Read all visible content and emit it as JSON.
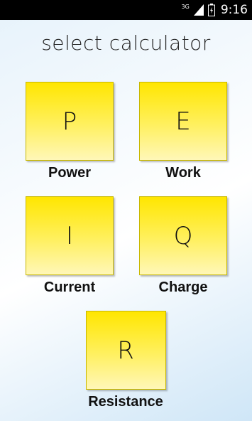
{
  "status_bar": {
    "network": "3G",
    "time": "9:16"
  },
  "title": "select calculator",
  "calculators": [
    {
      "letter": "P",
      "label": "Power"
    },
    {
      "letter": "E",
      "label": "Work"
    },
    {
      "letter": "I",
      "label": "Current"
    },
    {
      "letter": "Q",
      "label": "Charge"
    },
    {
      "letter": "R",
      "label": "Resistance"
    }
  ]
}
